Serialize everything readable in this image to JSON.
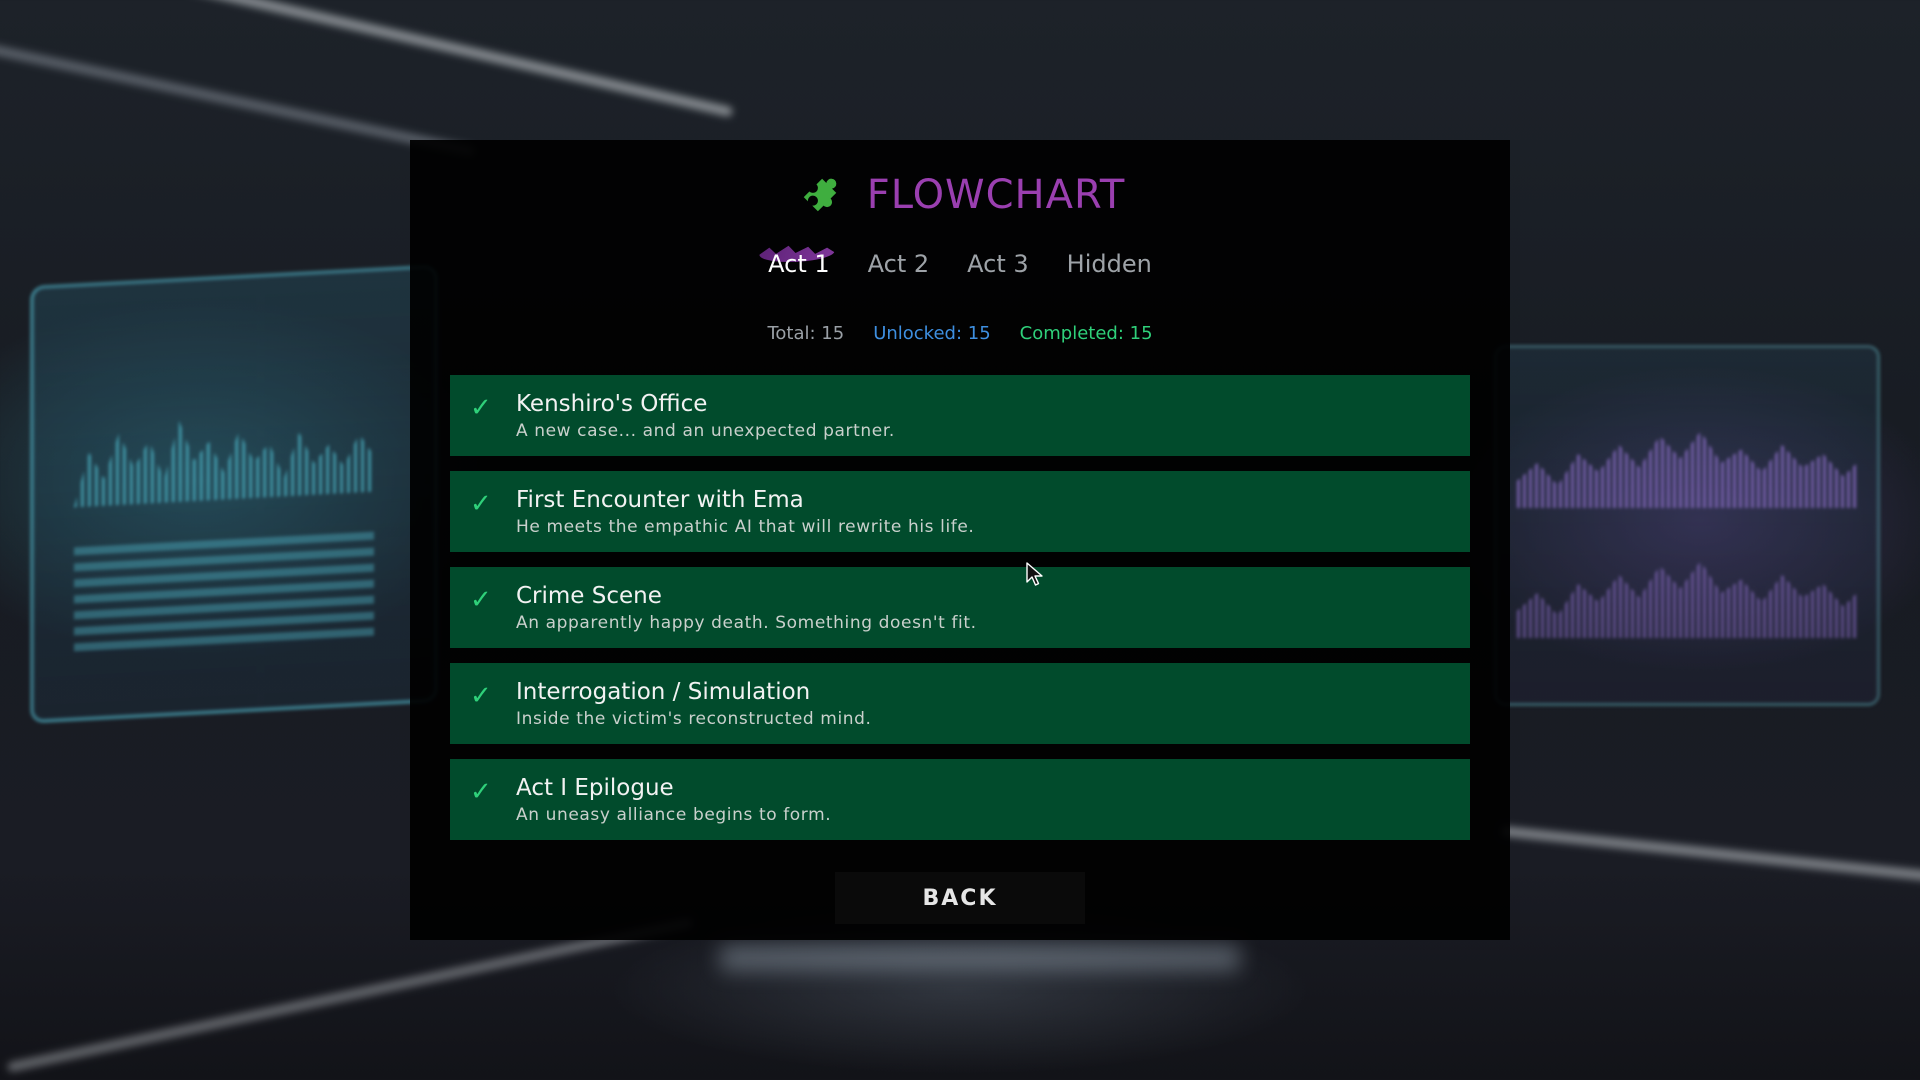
{
  "header": {
    "title": "FLOWCHART",
    "icon": "puzzle-piece-icon",
    "icon_color": "#3fae3f",
    "title_color": "#9a3fb0"
  },
  "tabs": [
    {
      "label": "Act 1",
      "active": true
    },
    {
      "label": "Act 2",
      "active": false
    },
    {
      "label": "Act 3",
      "active": false
    },
    {
      "label": "Hidden",
      "active": false
    }
  ],
  "stats": {
    "total": "Total: 15",
    "unlocked": "Unlocked: 15",
    "completed": "Completed: 15"
  },
  "chapters": [
    {
      "title": "Kenshiro's Office",
      "description": "A new case... and an unexpected partner.",
      "status": "completed"
    },
    {
      "title": "First Encounter with Ema",
      "description": "He meets the empathic AI that will rewrite his life.",
      "status": "completed"
    },
    {
      "title": "Crime Scene",
      "description": "An apparently happy death. Something doesn't fit.",
      "status": "completed"
    },
    {
      "title": "Interrogation / Simulation",
      "description": "Inside the victim's reconstructed mind.",
      "status": "completed"
    },
    {
      "title": "Act I Epilogue",
      "description": "An uneasy alliance begins to form.",
      "status": "completed"
    }
  ],
  "check_glyph": "✓",
  "back_label": "BACK",
  "colors": {
    "card_bg": "#014b2c",
    "check": "#2fd07a",
    "unlocked": "#3e8fe0",
    "completed": "#2fd07a"
  }
}
